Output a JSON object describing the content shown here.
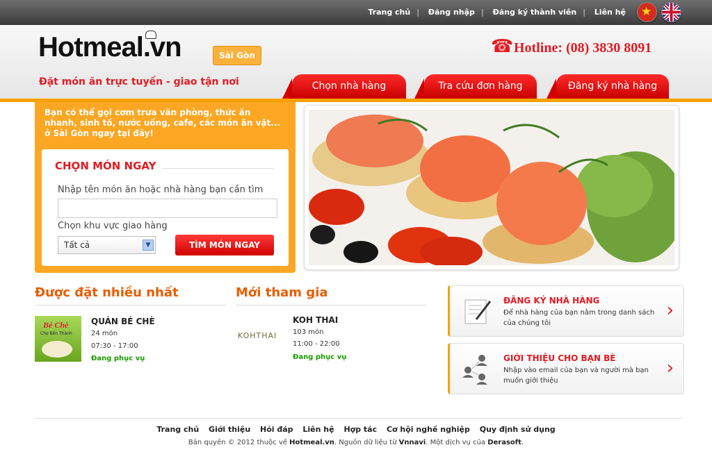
{
  "topnav": {
    "items": [
      "Trang chủ",
      "Đăng nhập",
      "Đăng ký thành viên",
      "Liên hệ"
    ]
  },
  "flags": {
    "vn": "vietnam-flag",
    "uk": "uk-flag"
  },
  "header": {
    "logo": "Hotmeal.vn",
    "city": "Sài Gòn",
    "tagline": "Đặt món ăn trực tuyến - giao tận nơi",
    "hotline": "Hotline: (08) 3830 8091"
  },
  "tabs": [
    "Chọn nhà hàng",
    "Tra cứu đơn hàng",
    "Đăng ký nhà hàng"
  ],
  "intro": "Bạn có thể gọi cơm trưa văn phòng, thức ăn nhanh, sinh tố, nước uống, cafe, các món ăn vặt... ở Sài Gòn ngay tại đây!",
  "search": {
    "title": "CHỌN MÓN NGAY",
    "query_label": "Nhập tên món ăn hoặc nhà hàng bạn cần tìm",
    "query_value": "",
    "area_label": "Chọn khu vực giao hàng",
    "area_value": "Tất cả",
    "button": "TÌM MÓN NGAY"
  },
  "popular": {
    "title": "Được đặt nhiều nhất",
    "name": "QUÁN BÉ CHÈ",
    "count": "24 món",
    "hours": "07:30 - 17:00",
    "status": "Đang phục vụ",
    "thumb_text": "Bé Chè",
    "thumb_sub": "Chợ Bến Thành"
  },
  "newest": {
    "title": "Mới tham gia",
    "name": "KOH THAI",
    "count": "103 món",
    "hours": "11:00 - 22:00",
    "status": "Đang phục vụ",
    "logo_text": "KOHTHAI"
  },
  "promos": [
    {
      "title": "ĐĂNG KÝ NHÀ HÀNG",
      "desc": "Để nhà hàng của bạn nằm trong danh sách của chúng tôi"
    },
    {
      "title": "GIỚI THIỆU CHO BẠN BÈ",
      "desc": "Nhập vào email của bạn và người mà bạn muốn giới thiệu"
    }
  ],
  "footer": {
    "links": [
      "Trang chủ",
      "Giới thiệu",
      "Hỏi đáp",
      "Liên hệ",
      "Hợp tác",
      "Cơ hội nghề nghiệp",
      "Quy định sử dụng"
    ],
    "copy_pre": "Bản quyền © 2012 thuộc về ",
    "copy_site": "Hotmeal.vn",
    "copy_mid": ". Nguồn dữ liệu từ ",
    "copy_src": "Vnnavi",
    "copy_mid2": ". Một dịch vụ của ",
    "copy_co": "Derasoft",
    "copy_end": "."
  },
  "colors": {
    "accent": "#e21b22",
    "orange": "#f7a100",
    "status": "#1a9a00"
  }
}
